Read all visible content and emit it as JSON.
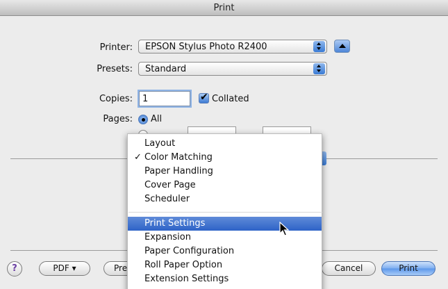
{
  "window": {
    "title": "Print"
  },
  "printer": {
    "label": "Printer:",
    "value": "EPSON Stylus Photo R2400"
  },
  "presets": {
    "label": "Presets:",
    "value": "Standard"
  },
  "copies": {
    "label": "Copies:",
    "value": "1",
    "collated_label": "Collated",
    "collated_checked": true
  },
  "pages": {
    "label": "Pages:",
    "all_label": "All",
    "all_selected": true
  },
  "menu": {
    "items_top": [
      {
        "label": "Layout",
        "checked": false
      },
      {
        "label": "Color Matching",
        "checked": true
      },
      {
        "label": "Paper Handling",
        "checked": false
      },
      {
        "label": "Cover Page",
        "checked": false
      },
      {
        "label": "Scheduler",
        "checked": false
      }
    ],
    "items_bottom": [
      {
        "label": "Print Settings",
        "highlighted": true
      },
      {
        "label": "Expansion"
      },
      {
        "label": "Paper Configuration"
      },
      {
        "label": "Roll Paper Option"
      },
      {
        "label": "Extension Settings"
      }
    ],
    "checkmark": "✓"
  },
  "footer": {
    "help_label": "?",
    "pdf_label": "PDF ▾",
    "preview_label_partial": "Pre",
    "cancel_label": "Cancel",
    "print_label": "Print"
  },
  "colors": {
    "accent": "#3a7bd5",
    "highlight": "#3a6fd0",
    "window_bg": "#ececec"
  },
  "icons": [
    "help-icon",
    "disclosure-triangle-icon",
    "popup-arrows-icon",
    "checkbox-icon",
    "radio-icon",
    "arrow-cursor-icon"
  ]
}
